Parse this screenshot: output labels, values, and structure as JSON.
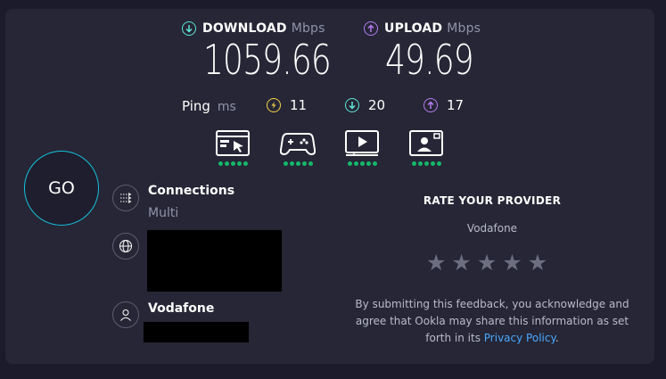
{
  "download": {
    "label": "DOWNLOAD",
    "unit": "Mbps",
    "value": "1059.66",
    "icon": "download-arrow-icon",
    "color": "#5ee6d6"
  },
  "upload": {
    "label": "UPLOAD",
    "unit": "Mbps",
    "value": "49.69",
    "icon": "upload-arrow-icon",
    "color": "#b57bf0"
  },
  "ping": {
    "label": "Ping",
    "unit": "ms",
    "idle": "11",
    "download": "20",
    "upload": "17",
    "colors": {
      "idle": "#f5d44a",
      "download": "#5ee6d6",
      "upload": "#b57bf0"
    }
  },
  "experience_icons": [
    {
      "name": "web-browsing-icon",
      "rating": 5
    },
    {
      "name": "gaming-icon",
      "rating": 5
    },
    {
      "name": "video-streaming-icon",
      "rating": 5
    },
    {
      "name": "video-chat-icon",
      "rating": 5
    }
  ],
  "go_button": {
    "label": "GO",
    "color": "#16c2dc"
  },
  "connections": {
    "title": "Connections",
    "value": "Multi"
  },
  "provider": {
    "name": "Vodafone"
  },
  "rate": {
    "title": "RATE YOUR PROVIDER",
    "provider": "Vodafone",
    "stars": 5,
    "disclaimer_before": "By submitting this feedback, you acknowledge and agree that Ookla may share this information as set forth in its ",
    "link_text": "Privacy Policy",
    "disclaimer_after": "."
  }
}
